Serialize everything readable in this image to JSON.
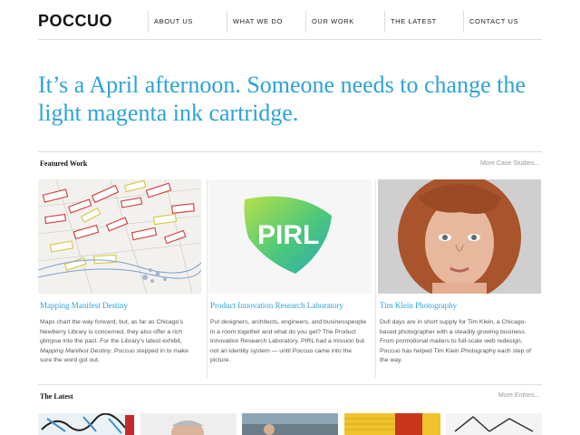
{
  "header": {
    "logo": "POCCUO",
    "nav": [
      "ABOUT US",
      "WHAT WE DO",
      "OUR WORK",
      "THE LATEST",
      "CONTACT US"
    ]
  },
  "headline": "It’s a April afternoon. Someone needs to change the light magenta ink cartridge.",
  "featured": {
    "title": "Featured Work",
    "more": "More Case Studies...",
    "cards": [
      {
        "title": "Mapping Manifest Destiny",
        "desc_before": "Maps chart the way forward, but, as far as Chicago’s Newberry Library is concerned, they also offer a rich glimpse into the past. For the Library’s latest exhibit, ",
        "desc_em": "Mapping Manifest Destiny",
        "desc_after": ", Poccuo stepped in to make sure the word got out."
      },
      {
        "title": "Product Innovation Research Laboratory",
        "logo_text": "PIRL",
        "desc": "Put designers, architects, engineers, and businesspeople in a room together and what do you get? The Product Innovation Research Laboratory. PIRL had a mission but not an identity system — until Poccuo came into the picture."
      },
      {
        "title": "Tim Klein Photography",
        "desc": "Dull days are in short supply for Tim Klein, a Chicago-based photographer with a steadily growing business. From promotional mailers to full-scale web redesign, Poccuo has helped Tim Klein Photography each step of the way."
      }
    ]
  },
  "latest": {
    "title": "The Latest",
    "more": "More Entries..."
  }
}
